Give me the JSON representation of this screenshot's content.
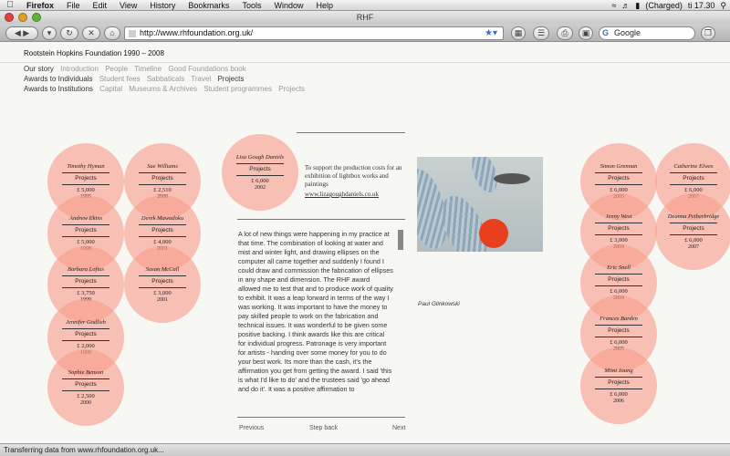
{
  "menubar": {
    "app": "Firefox",
    "items": [
      "File",
      "Edit",
      "View",
      "History",
      "Bookmarks",
      "Tools",
      "Window",
      "Help"
    ],
    "battery": "(Charged)",
    "clock": "ti 17.30"
  },
  "window": {
    "title": "RHF"
  },
  "toolbar": {
    "url": "http://www.rhfoundation.org.uk/",
    "search_placeholder": "Google"
  },
  "site": {
    "title": "Rootstein Hopkins Foundation 1990 – 2008"
  },
  "nav": {
    "row1": {
      "head": "Our story",
      "items": [
        "Introduction",
        "People",
        "Timeline",
        "Good Foundations book"
      ]
    },
    "row2": {
      "head": "Awards to Individuals",
      "items": [
        "Student fees",
        "Sabbaticals",
        "Travel"
      ],
      "current": "Projects"
    },
    "row3": {
      "head": "Awards to Institutions",
      "items": [
        "Capital",
        "Museums & Archives",
        "Student programmes",
        "Projects"
      ]
    }
  },
  "circles": [
    {
      "name": "Timothy Hyman",
      "label": "Projects",
      "amount": "£ 5,000",
      "year": "1995"
    },
    {
      "name": "Sue Williams",
      "label": "Projects",
      "amount": "£ 2,510",
      "year": "2000"
    },
    {
      "name": "Andrew Ekins",
      "label": "Projects",
      "amount": "£ 5,000",
      "year": "1998"
    },
    {
      "name": "Derek Mawudoku",
      "label": "Projects",
      "amount": "£ 4,000",
      "year": "2001"
    },
    {
      "name": "Barbara Loftus",
      "label": "Projects",
      "amount": "£ 3,750",
      "year": "1999"
    },
    {
      "name": "Susan McCall",
      "label": "Projects",
      "amount": "£ 3,000",
      "year": "2001"
    },
    {
      "name": "Jennifer Godlieb",
      "label": "Projects",
      "amount": "£ 2,000",
      "year": "1999"
    },
    {
      "name": "Sophie Benson",
      "label": "Projects",
      "amount": "£ 2,500",
      "year": "2000"
    },
    {
      "name": "Lisa Gough Daniels",
      "label": "Projects",
      "amount": "£ 6,000",
      "year": "2002"
    },
    {
      "name": "Simon Grennan",
      "label": "Projects",
      "amount": "£ 6,000",
      "year": "2003"
    },
    {
      "name": "Catherine Elwes",
      "label": "Projects",
      "amount": "£ 6,000",
      "year": "2007"
    },
    {
      "name": "Jenny West",
      "label": "Projects",
      "amount": "£ 3,000",
      "year": "2004"
    },
    {
      "name": "Deanna Petherbridge",
      "label": "Projects",
      "amount": "£ 6,000",
      "year": "2007"
    },
    {
      "name": "Eric Snell",
      "label": "Projects",
      "amount": "£ 6,000",
      "year": "2004"
    },
    {
      "name": "Frances Barden",
      "label": "Projects",
      "amount": "£ 6,000",
      "year": "2005"
    },
    {
      "name": "Mimi Joung",
      "label": "Projects",
      "amount": "£ 6,000",
      "year": "2006"
    }
  ],
  "detail": {
    "support": "To support the production costs for an exhibition of lightbox works and paintings",
    "link": "www.lizagoughdaniels.co.uk",
    "body": "A lot of new things were happening in my practice at that time. The combination of looking at water and mist and winter light, and drawing ellipses on the computer all came together and suddenly I found I could draw and commission the fabrication of ellipses in any shape and dimension. The RHF award allowed me to test that and to produce work of quality to exhibit. It was a leap forward in terms of the way I was working. It was important to have the money to pay skilled people to work on the fabrication and technical issues. It was wonderful to be given some positive backing. I think awards like this are critical for individual progress. Patronage is very important for artists - handing over some money for you to do your best work. Its more than the cash, it's the affirmation you get from getting the award. I said 'this is what I'd like to do' and the trustees said 'go ahead and do it'. It was a positive affirmation to",
    "prev": "Previous",
    "back": "Step back",
    "next": "Next",
    "caption": "Paul Glinkowski"
  },
  "status": {
    "text": "Transferring data from www.rhfoundation.org.uk..."
  }
}
